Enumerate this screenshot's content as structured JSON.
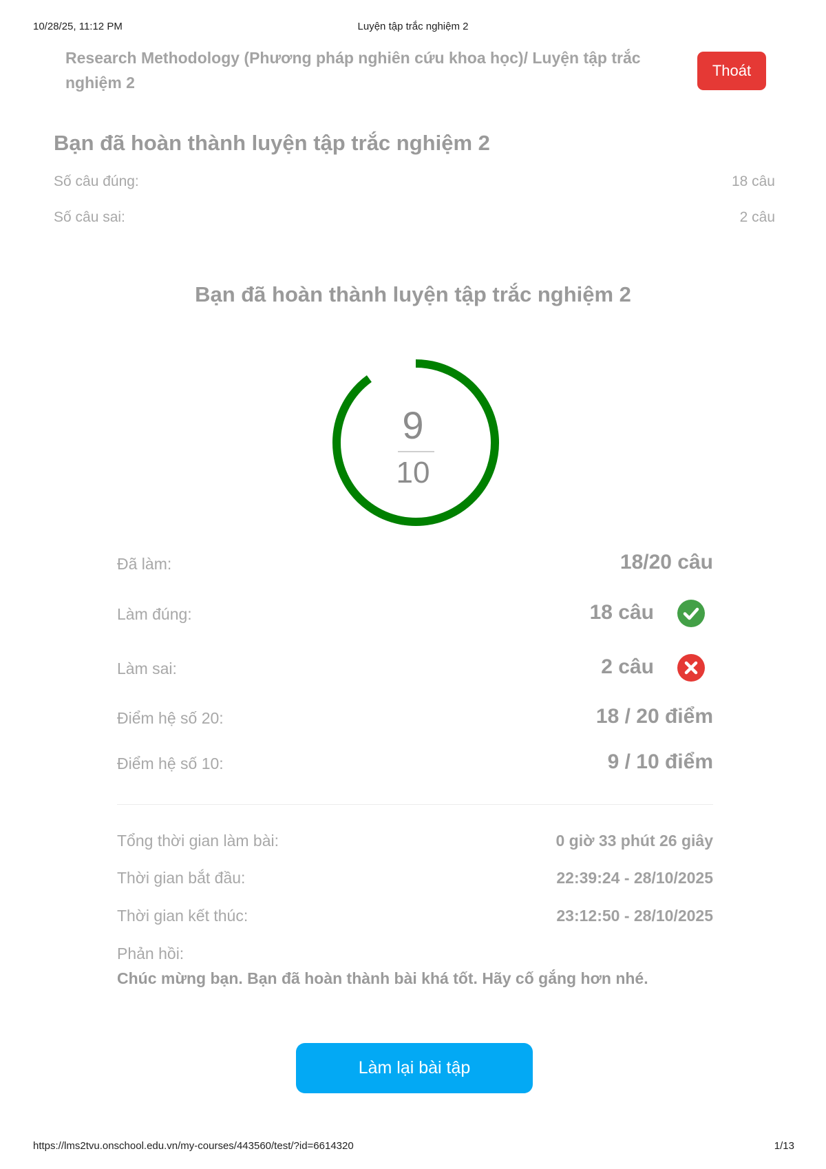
{
  "print_header": {
    "datetime": "10/28/25, 11:12 PM",
    "title": "Luyện tập trắc nghiệm 2"
  },
  "header": {
    "breadcrumb": "Research Methodology (Phương pháp nghiên cứu khoa học)/ Luyện tập trắc nghiệm 2",
    "exit_label": "Thoát",
    "exit_color": "#e53935"
  },
  "summary": {
    "title": "Bạn đã hoàn thành luyện tập trắc nghiệm 2",
    "correct_label": "Số câu đúng:",
    "correct_value": "18 câu",
    "wrong_label": "Số câu sai:",
    "wrong_value": "2 câu"
  },
  "result": {
    "title": "Bạn đã hoàn thành luyện tập trắc nghiệm 2",
    "score": "9",
    "max_score": "10",
    "ring_color": "#008000",
    "ring_progress": 0.9
  },
  "stats": {
    "done_label": "Đã làm:",
    "done_value": "18/20 câu",
    "correct_label": "Làm đúng:",
    "correct_value": "18 câu",
    "correct_icon": "check-circle-icon",
    "correct_color": "#43a047",
    "wrong_label": "Làm sai:",
    "wrong_value": "2 câu",
    "wrong_icon": "x-circle-icon",
    "wrong_color": "#e53935",
    "score20_label": "Điểm hệ số 20:",
    "score20_value": "18 / 20 điểm",
    "score10_label": "Điểm hệ số 10:",
    "score10_value": "9 / 10 điểm"
  },
  "times": {
    "total_label": "Tổng thời gian làm bài:",
    "total_value": "0 giờ 33 phút 26 giây",
    "start_label": "Thời gian bắt đầu:",
    "start_value": "22:39:24 - 28/10/2025",
    "end_label": "Thời gian kết thúc:",
    "end_value": "23:12:50 - 28/10/2025"
  },
  "feedback": {
    "label": "Phản hồi:",
    "text": "Chúc mừng bạn. Bạn đã hoàn thành bài khá tốt. Hãy cố gắng hơn nhé."
  },
  "actions": {
    "retry_label": "Làm lại bài tập",
    "retry_color": "#03a9f4"
  },
  "print_footer": {
    "url": "https://lms2tvu.onschool.edu.vn/my-courses/443560/test/?id=6614320",
    "page": "1/13"
  }
}
